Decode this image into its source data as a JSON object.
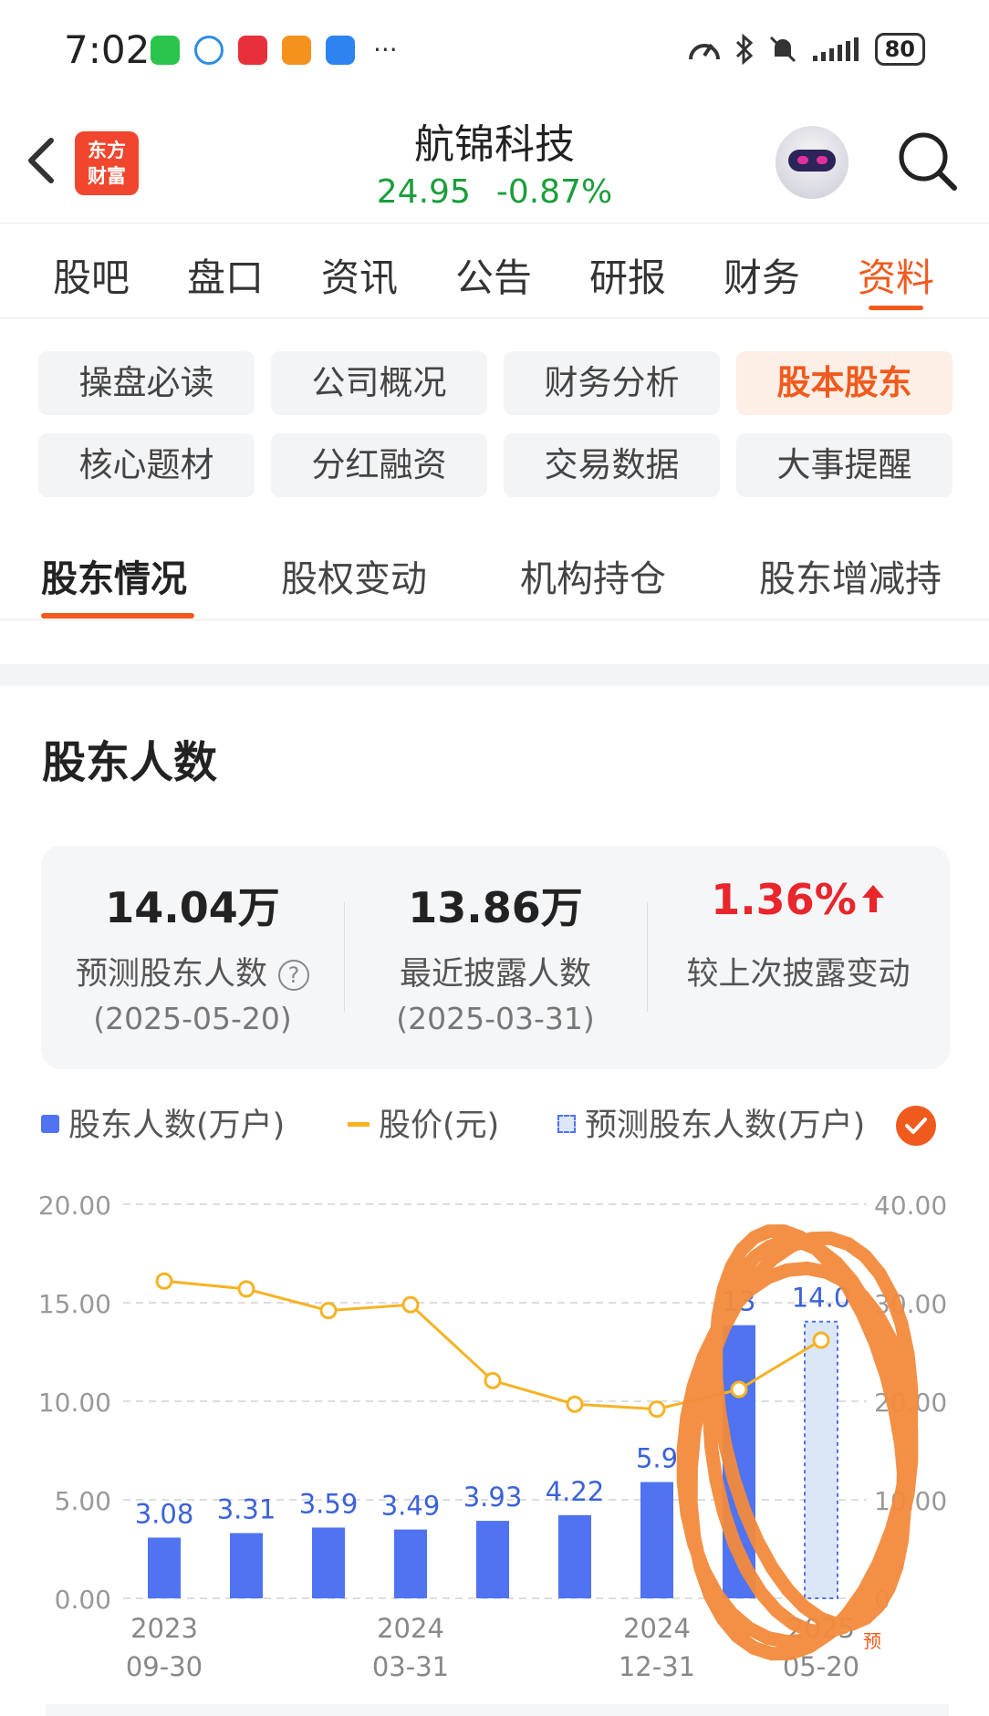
{
  "status_bar": {
    "time": "7:02",
    "battery": "80",
    "app_icons": [
      "wechat-icon",
      "browser-icon",
      "huawei-store-icon",
      "video-app-icon",
      "weather-icon"
    ],
    "more": "···"
  },
  "header": {
    "logo_line1": "东方",
    "logo_line2": "财富",
    "title": "航锦科技",
    "price": "24.95",
    "change": "-0.87%",
    "quote_color": "#1a9e3a"
  },
  "main_tabs": [
    {
      "label": "股吧",
      "active": false
    },
    {
      "label": "盘口",
      "active": false
    },
    {
      "label": "资讯",
      "active": false
    },
    {
      "label": "公告",
      "active": false
    },
    {
      "label": "研报",
      "active": false
    },
    {
      "label": "财务",
      "active": false
    },
    {
      "label": "资料",
      "active": true
    }
  ],
  "sub_nav": [
    {
      "label": "操盘必读",
      "active": false
    },
    {
      "label": "公司概况",
      "active": false
    },
    {
      "label": "财务分析",
      "active": false
    },
    {
      "label": "股本股东",
      "active": true
    },
    {
      "label": "核心题材",
      "active": false
    },
    {
      "label": "分红融资",
      "active": false
    },
    {
      "label": "交易数据",
      "active": false
    },
    {
      "label": "大事提醒",
      "active": false
    }
  ],
  "sub_tabs": [
    {
      "label": "股东情况",
      "active": true
    },
    {
      "label": "股权变动",
      "active": false
    },
    {
      "label": "机构持仓",
      "active": false
    },
    {
      "label": "股东增减持",
      "active": false
    }
  ],
  "section_title": "股东人数",
  "summary": {
    "predicted_value": "14.04万",
    "predicted_label": "预测股东人数",
    "predicted_date": "(2025-05-20)",
    "latest_value": "13.86万",
    "latest_label": "最近披露人数",
    "latest_date": "(2025-03-31)",
    "change_value": "1.36%",
    "change_label": "较上次披露变动"
  },
  "legend": {
    "holders": "股东人数(万户)",
    "price": "股价(元)",
    "predicted": "预测股东人数(万户)"
  },
  "colors": {
    "accent": "#f05a1d",
    "bar": "#4f73f1",
    "line": "#f5b324",
    "positive_red": "#e8262c"
  },
  "chart_data": {
    "type": "bar+line",
    "left_axis_ticks": [
      "20.00",
      "15.00",
      "10.00",
      "5.00",
      "0.00"
    ],
    "right_axis_ticks": [
      "40.00",
      "30.00",
      "20.00",
      "10.00",
      "0"
    ],
    "ylim_left": [
      0,
      20
    ],
    "ylim_right": [
      0,
      40
    ],
    "x_tick_labels": [
      {
        "index": 0,
        "year": "2023",
        "date": "09-30"
      },
      {
        "index": 3,
        "year": "2024",
        "date": "03-31"
      },
      {
        "index": 6,
        "year": "2024",
        "date": "12-31"
      },
      {
        "index": 8,
        "year": "2025",
        "date": "05-20"
      }
    ],
    "series": [
      {
        "name": "股东人数(万户)",
        "kind": "bar",
        "values": [
          3.08,
          3.31,
          3.59,
          3.49,
          3.93,
          4.22,
          5.9,
          13.86
        ],
        "labels": [
          "3.08",
          "3.31",
          "3.59",
          "3.49",
          "3.93",
          "4.22",
          "5.9",
          "13"
        ]
      },
      {
        "name": "预测股东人数(万户)",
        "kind": "bar-dashed",
        "index": 8,
        "value": 14.04,
        "label": "14.0",
        "tag": "预"
      },
      {
        "name": "股价(元)",
        "kind": "line",
        "values": [
          32.2,
          31.4,
          29.2,
          29.8,
          22.1,
          19.7,
          19.2,
          21.2,
          26.2
        ]
      }
    ],
    "annotation": "orange hand-drawn circle around last two bars"
  }
}
